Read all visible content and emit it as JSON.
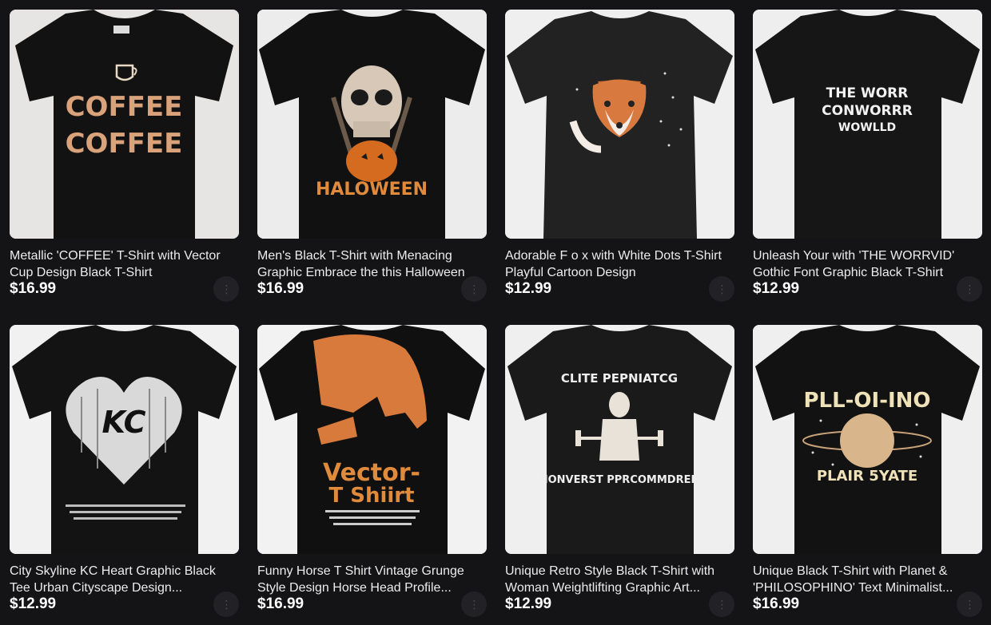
{
  "products": [
    {
      "title": "Metallic 'COFFEE' T-Shirt with Vector Cup Design Black T-Shirt",
      "price": "$16.99",
      "print": [
        "COFFEE",
        "COFFEE"
      ],
      "more_icon": "more-options-icon"
    },
    {
      "title": "Men's Black T-Shirt with Menacing Graphic Embrace the this Halloween",
      "price": "$16.99",
      "print": [
        "HALOWEEN"
      ],
      "more_icon": "more-options-icon"
    },
    {
      "title": "Adorable F o x with White Dots T-Shirt Playful Cartoon Design",
      "price": "$12.99",
      "print": [],
      "more_icon": "more-options-icon"
    },
    {
      "title": "Unleash Your with 'THE WORRVID' Gothic Font Graphic Black T-Shirt",
      "price": "$12.99",
      "print": [
        "THE WORR",
        "CONWORRR",
        "WOWLLD"
      ],
      "more_icon": "more-options-icon"
    },
    {
      "title": "City Skyline KC Heart Graphic Black Tee Urban Cityscape Design...",
      "price": "$12.99",
      "print": [
        "KC"
      ],
      "more_icon": "more-options-icon"
    },
    {
      "title": "Funny Horse T Shirt Vintage Grunge Style Design Horse Head Profile...",
      "price": "$16.99",
      "print": [
        "Vector-",
        "T Shiirt"
      ],
      "more_icon": "more-options-icon"
    },
    {
      "title": "Unique Retro Style Black T-Shirt with Woman Weightlifting Graphic Art...",
      "price": "$12.99",
      "print": [
        "CLITE PEPNIATCG",
        "NONVERST PPRCOMMDRED"
      ],
      "more_icon": "more-options-icon"
    },
    {
      "title": "Unique Black T-Shirt with Planet & 'PHILOSOPHINO' Text Minimalist...",
      "price": "$16.99",
      "print": [
        "PLL-OI-INO",
        "PLAIR 5YATE"
      ],
      "more_icon": "more-options-icon"
    }
  ]
}
